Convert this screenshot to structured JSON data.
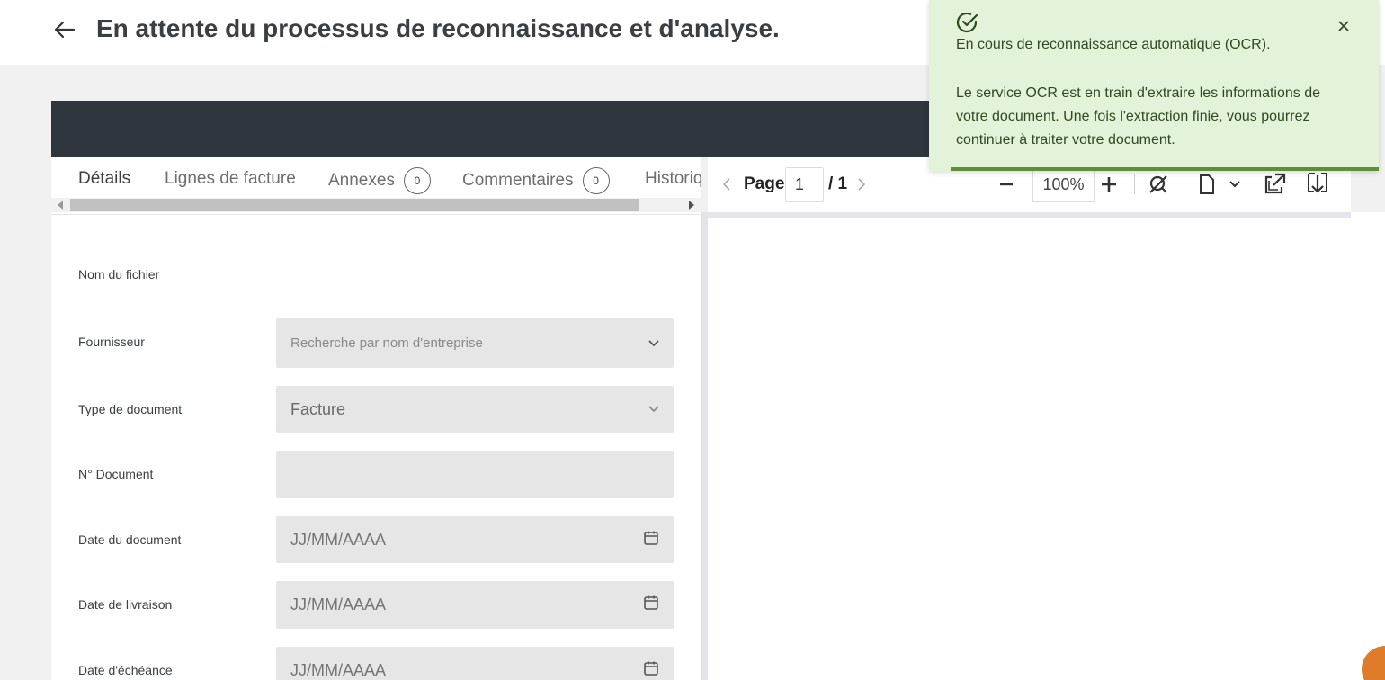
{
  "header": {
    "title": "En attente du processus de reconnaissance et d'analyse."
  },
  "tabs": [
    {
      "label": "Détails"
    },
    {
      "label": "Lignes de facture"
    },
    {
      "label": "Annexes",
      "count": "0"
    },
    {
      "label": "Commentaires",
      "count": "0"
    },
    {
      "label": "Historiq"
    }
  ],
  "form": {
    "file_name_label": "Nom du fichier",
    "supplier_label": "Fournisseur",
    "supplier_placeholder": "Recherche par nom d'entreprise",
    "doc_type_label": "Type de document",
    "doc_type_value": "Facture",
    "doc_number_label": "N° Document",
    "doc_date_label": "Date du document",
    "doc_date_placeholder": "JJ/MM/AAAA",
    "delivery_date_label": "Date de livraison",
    "delivery_date_placeholder": "JJ/MM/AAAA",
    "due_date_label": "Date d'échéance",
    "due_date_placeholder": "JJ/MM/AAAA"
  },
  "viewer": {
    "page_label": "Page",
    "page_current": "1",
    "page_total": "/ 1",
    "zoom": "100%"
  },
  "toast": {
    "title": "En cours de reconnaissance automatique (OCR).",
    "message": "Le service OCR est en train d'extraire les informations de votre document. Une fois l'extraction finie, vous pourrez continuer à traiter votre document.",
    "accent_color": "#5c8f36",
    "background_color": "#e3f3d9"
  }
}
